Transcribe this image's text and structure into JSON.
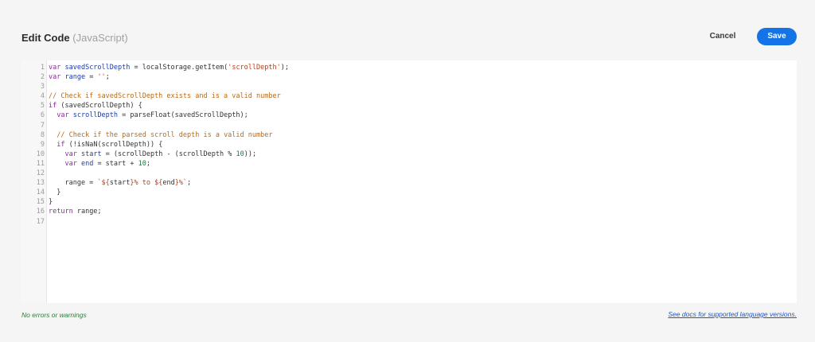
{
  "header": {
    "title": "Edit Code",
    "language": "(JavaScript)",
    "cancel_label": "Cancel",
    "save_label": "Save"
  },
  "editor": {
    "line_numbers": [
      "1",
      "2",
      "3",
      "4",
      "5",
      "6",
      "7",
      "8",
      "9",
      "10",
      "11",
      "12",
      "13",
      "14",
      "15",
      "16",
      "17"
    ],
    "lines": [
      [
        {
          "t": "var ",
          "c": "kw"
        },
        {
          "t": "savedScrollDepth",
          "c": "var"
        },
        {
          "t": " = localStorage.getItem(",
          "c": "fn"
        },
        {
          "t": "'scrollDepth'",
          "c": "str"
        },
        {
          "t": ");",
          "c": "fn"
        }
      ],
      [
        {
          "t": "var ",
          "c": "kw"
        },
        {
          "t": "range",
          "c": "var"
        },
        {
          "t": " = ",
          "c": "fn"
        },
        {
          "t": "''",
          "c": "str"
        },
        {
          "t": ";",
          "c": "fn"
        }
      ],
      [],
      [
        {
          "t": "// Check if savedScrollDepth exists and is a valid number",
          "c": "cm"
        }
      ],
      [
        {
          "t": "if",
          "c": "kw"
        },
        {
          "t": " (savedScrollDepth) {",
          "c": "fn"
        }
      ],
      [
        {
          "t": "  ",
          "c": "fn"
        },
        {
          "t": "var ",
          "c": "kw"
        },
        {
          "t": "scrollDepth",
          "c": "var"
        },
        {
          "t": " = parseFloat(savedScrollDepth);",
          "c": "fn"
        }
      ],
      [],
      [
        {
          "t": "  ",
          "c": "fn"
        },
        {
          "t": "// Check if the parsed scroll depth is a valid number",
          "c": "cm"
        }
      ],
      [
        {
          "t": "  ",
          "c": "fn"
        },
        {
          "t": "if",
          "c": "kw"
        },
        {
          "t": " (!isNaN(scrollDepth)) {",
          "c": "fn"
        }
      ],
      [
        {
          "t": "    ",
          "c": "fn"
        },
        {
          "t": "var ",
          "c": "kw"
        },
        {
          "t": "start",
          "c": "var"
        },
        {
          "t": " = (scrollDepth - (scrollDepth % ",
          "c": "fn"
        },
        {
          "t": "10",
          "c": "num"
        },
        {
          "t": "));",
          "c": "fn"
        }
      ],
      [
        {
          "t": "    ",
          "c": "fn"
        },
        {
          "t": "var ",
          "c": "kw"
        },
        {
          "t": "end",
          "c": "var"
        },
        {
          "t": " = start + ",
          "c": "fn"
        },
        {
          "t": "10",
          "c": "num"
        },
        {
          "t": ";",
          "c": "fn"
        }
      ],
      [],
      [
        {
          "t": "    range = ",
          "c": "fn"
        },
        {
          "t": "`${",
          "c": "str"
        },
        {
          "t": "start",
          "c": "fn"
        },
        {
          "t": "}% to ${",
          "c": "str"
        },
        {
          "t": "end",
          "c": "fn"
        },
        {
          "t": "}%`",
          "c": "str"
        },
        {
          "t": ";",
          "c": "fn"
        }
      ],
      [
        {
          "t": "  }",
          "c": "fn"
        }
      ],
      [
        {
          "t": "}",
          "c": "fn"
        }
      ],
      [
        {
          "t": "return",
          "c": "kw"
        },
        {
          "t": " range;",
          "c": "fn"
        }
      ],
      []
    ]
  },
  "footer": {
    "status": "No errors or warnings",
    "docs_link": "See docs for supported language versions."
  },
  "colors": {
    "accent": "#1473e6",
    "status_ok": "#2d7a3a",
    "link": "#1e55c8"
  }
}
